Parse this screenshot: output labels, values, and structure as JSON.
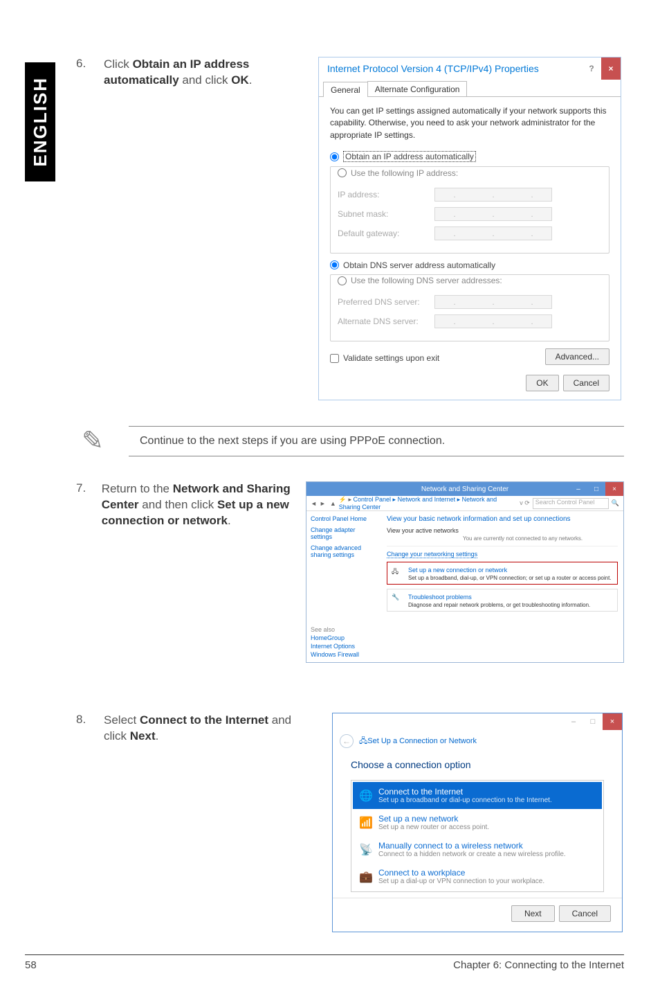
{
  "sidebarLabel": "ENGLISH",
  "steps": {
    "s6": {
      "num": "6.",
      "text_pre": "Click ",
      "bold1": "Obtain an IP address automatically",
      "mid": " and click ",
      "bold2": "OK",
      "end": "."
    },
    "s7": {
      "num": "7.",
      "text_pre": "Return to the ",
      "bold1": "Network and Sharing Center",
      "mid": " and then click ",
      "bold2": "Set up a new connection or network",
      "end": "."
    },
    "s8": {
      "num": "8.",
      "text_pre": "Select ",
      "bold1": "Connect to the Internet",
      "mid": " and click ",
      "bold2": "Next",
      "end": "."
    }
  },
  "note": "Continue to the next steps if you are using PPPoE connection.",
  "ipv4": {
    "title": "Internet Protocol Version 4 (TCP/IPv4) Properties",
    "help": "?",
    "close": "×",
    "tabGeneral": "General",
    "tabAlt": "Alternate Configuration",
    "desc": "You can get IP settings assigned automatically if your network supports this capability. Otherwise, you need to ask your network administrator for the appropriate IP settings.",
    "radioObtainIP": "Obtain an IP address automatically",
    "radioUseIP": "Use the following IP address:",
    "ipAddress": "IP address:",
    "subnet": "Subnet mask:",
    "gateway": "Default gateway:",
    "radioObtainDNS": "Obtain DNS server address automatically",
    "radioUseDNS": "Use the following DNS server addresses:",
    "prefDNS": "Preferred DNS server:",
    "altDNS": "Alternate DNS server:",
    "validate": "Validate settings upon exit",
    "advanced": "Advanced...",
    "ok": "OK",
    "cancel": "Cancel"
  },
  "nsc": {
    "title": "Network and Sharing Center",
    "breadcrumb": "Control Panel ▸ Network and Internet ▸ Network and Sharing Center",
    "searchPlaceholder": "Search Control Panel",
    "sideHome": "Control Panel Home",
    "sideAdapter": "Change adapter settings",
    "sideSharing": "Change advanced sharing settings",
    "hdr": "View your basic network information and set up connections",
    "activeHdr": "View your active networks",
    "activeSub": "You are currently not connected to any networks.",
    "changeHdr": "Change your networking settings",
    "opt1Title": "Set up a new connection or network",
    "opt1Sub": "Set up a broadband, dial-up, or VPN connection; or set up a router or access point.",
    "opt2Title": "Troubleshoot problems",
    "opt2Sub": "Diagnose and repair network problems, or get troubleshooting information.",
    "seeAlso": "See also",
    "homegroup": "HomeGroup",
    "internetOptions": "Internet Options",
    "firewall": "Windows Firewall"
  },
  "wiz": {
    "crumb": "Set Up a Connection or Network",
    "hdr": "Choose a connection option",
    "opt1t": "Connect to the Internet",
    "opt1s": "Set up a broadband or dial-up connection to the Internet.",
    "opt2t": "Set up a new network",
    "opt2s": "Set up a new router or access point.",
    "opt3t": "Manually connect to a wireless network",
    "opt3s": "Connect to a hidden network or create a new wireless profile.",
    "opt4t": "Connect to a workplace",
    "opt4s": "Set up a dial-up or VPN connection to your workplace.",
    "next": "Next",
    "cancel": "Cancel"
  },
  "footer": {
    "page": "58",
    "chapter": "Chapter 6: Connecting to the Internet"
  }
}
